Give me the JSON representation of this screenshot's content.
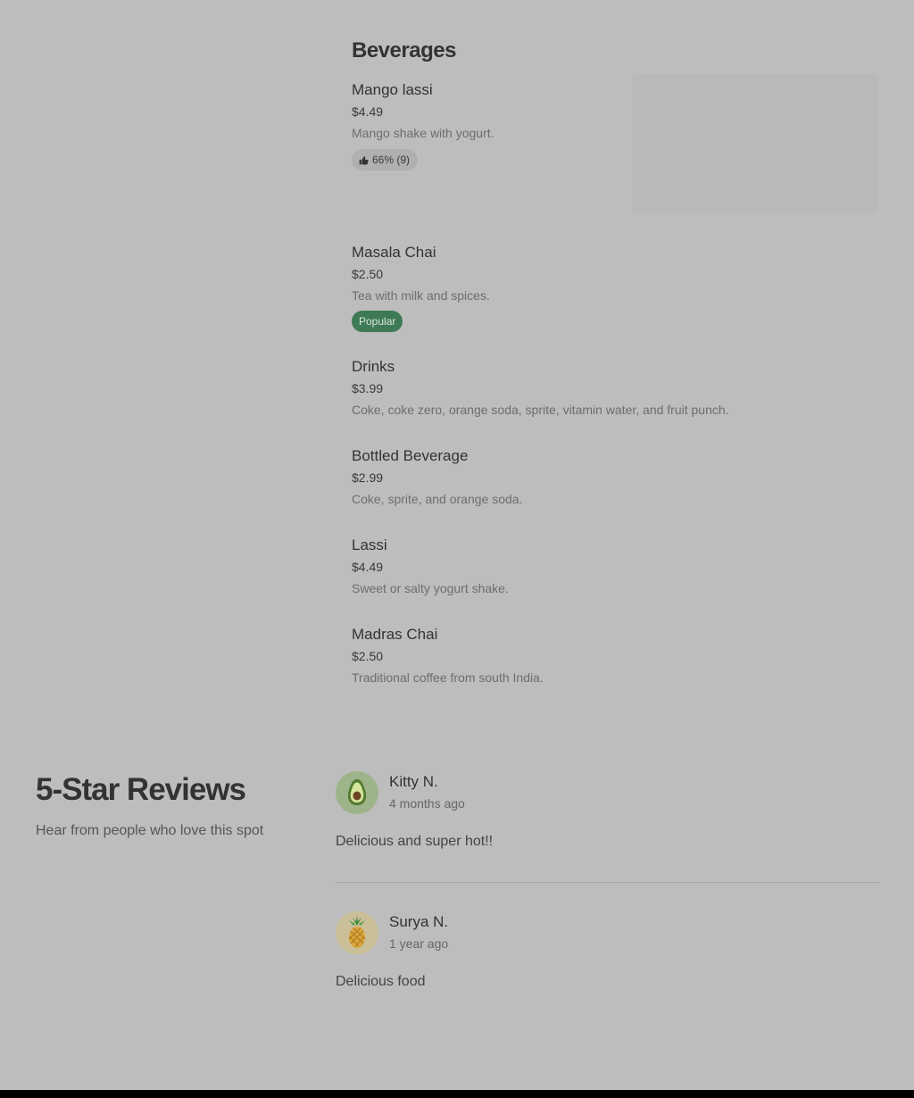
{
  "menu": {
    "section_title": "Beverages",
    "items": [
      {
        "name": "Mango lassi",
        "price": "$4.49",
        "description": "Mango shake with yogurt.",
        "rating": "66% (9)"
      },
      {
        "name": "Masala Chai",
        "price": "$2.50",
        "description": "Tea with milk and spices.",
        "badge": "Popular"
      },
      {
        "name": "Drinks",
        "price": "$3.99",
        "description": "Coke, coke zero, orange soda, sprite, vitamin water, and fruit punch."
      },
      {
        "name": "Bottled Beverage",
        "price": "$2.99",
        "description": "Coke, sprite, and orange soda."
      },
      {
        "name": "Lassi",
        "price": "$4.49",
        "description": "Sweet or salty yogurt shake."
      },
      {
        "name": "Madras Chai",
        "price": "$2.50",
        "description": "Traditional coffee from south India."
      }
    ]
  },
  "reviews": {
    "heading": "5-Star Reviews",
    "subheading": "Hear from people who love this spot",
    "items": [
      {
        "name": "Kitty N.",
        "date": "4 months ago",
        "text": "Delicious and super hot!!",
        "avatar_icon": "avocado-icon"
      },
      {
        "name": "Surya N.",
        "date": "1 year ago",
        "text": "Delicious food",
        "avatar_icon": "pineapple-icon"
      }
    ]
  },
  "colors": {
    "page_background": "#bdbdbd",
    "popular_badge": "#3d7a55",
    "footer": "#000000"
  }
}
